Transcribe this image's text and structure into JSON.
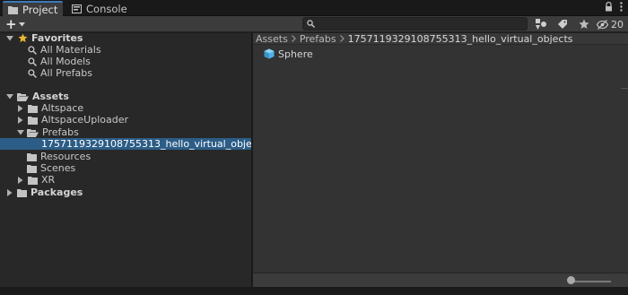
{
  "tabs": [
    {
      "label": "Project",
      "icon": "folder-icon",
      "active": true
    },
    {
      "label": "Console",
      "icon": "console-icon",
      "active": false
    }
  ],
  "toolbar": {
    "add_label": "+",
    "search_value": "",
    "hidden_count": "20"
  },
  "tree": {
    "favorites": {
      "label": "Favorites",
      "items": [
        "All Materials",
        "All Models",
        "All Prefabs"
      ]
    },
    "assets": {
      "label": "Assets",
      "children": [
        "Altspace",
        "AltspaceUploader",
        "Prefabs",
        "1757119329108755313_hello_virtual_objects",
        "Resources",
        "Scenes",
        "XR"
      ]
    },
    "packages": {
      "label": "Packages"
    }
  },
  "breadcrumb": [
    "Assets",
    "Prefabs",
    "1757119329108755313_hello_virtual_objects"
  ],
  "assets": [
    {
      "label": "Sphere",
      "icon": "prefab-cube-icon"
    }
  ],
  "colors": {
    "accent": "#3a79bb",
    "selection": "#2c5d87",
    "star": "#e8b730",
    "prefab": "#4fb3e8"
  }
}
